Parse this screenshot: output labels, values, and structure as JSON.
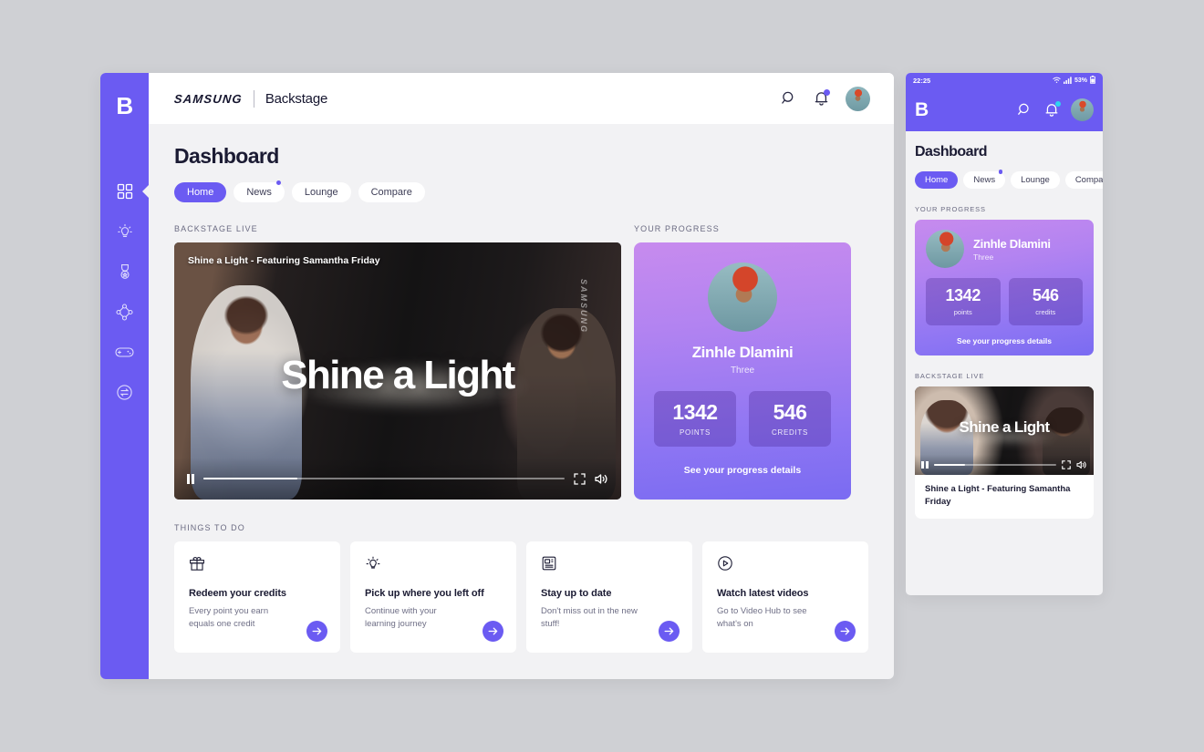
{
  "desktop": {
    "sidebar": {
      "brand_initial": "B",
      "items": [
        {
          "name": "dashboard",
          "icon": "grid-icon",
          "active": true
        },
        {
          "name": "ideas",
          "icon": "lightbulb-icon",
          "active": false
        },
        {
          "name": "awards",
          "icon": "medal-icon",
          "active": false
        },
        {
          "name": "network",
          "icon": "nodes-icon",
          "active": false
        },
        {
          "name": "games",
          "icon": "gamepad-icon",
          "active": false
        },
        {
          "name": "transfer",
          "icon": "swap-circle-icon",
          "active": false
        }
      ]
    },
    "topbar": {
      "samsung": "SAMSUNG",
      "product": "Backstage",
      "search_icon": "search-icon",
      "bell_icon": "bell-icon",
      "avatar": "user-avatar"
    },
    "page_title": "Dashboard",
    "tabs": [
      {
        "label": "Home",
        "active": true,
        "dot": false
      },
      {
        "label": "News",
        "active": false,
        "dot": true
      },
      {
        "label": "Lounge",
        "active": false,
        "dot": false
      },
      {
        "label": "Compare",
        "active": false,
        "dot": false
      }
    ],
    "live": {
      "section_label": "BACKSTAGE LIVE",
      "overlay_title": "Shine a Light - Featuring Samantha Friday",
      "headline": "Shine a Light",
      "watermark": "SAMSUNG",
      "progress_percent": 26
    },
    "progress": {
      "section_label": "YOUR PROGRESS",
      "name": "Zinhle Dlamini",
      "level": "Three",
      "stats": [
        {
          "value": "1342",
          "label": "POINTS"
        },
        {
          "value": "546",
          "label": "CREDITS"
        }
      ],
      "link": "See your progress details"
    },
    "todo": {
      "section_label": "THINGS TO DO",
      "cards": [
        {
          "icon": "gift-icon",
          "title": "Redeem your credits",
          "desc": "Every point you earn equals one credit"
        },
        {
          "icon": "lightbulb-icon",
          "title": "Pick up where you left off",
          "desc": "Continue with your learning journey"
        },
        {
          "icon": "article-icon",
          "title": "Stay up to date",
          "desc": "Don't miss out in the new stuff!"
        },
        {
          "icon": "play-circle-icon",
          "title": "Watch latest videos",
          "desc": "Go to Video Hub to see what's on"
        }
      ]
    }
  },
  "mobile": {
    "status_bar": {
      "time": "22:25",
      "wifi_icon": "wifi-icon",
      "signal_icon": "signal-icon",
      "battery_text": "53%",
      "battery_icon": "battery-icon"
    },
    "header": {
      "brand_initial": "B",
      "search_icon": "search-icon",
      "bell_icon": "bell-icon",
      "avatar": "user-avatar"
    },
    "page_title": "Dashboard",
    "tabs": [
      {
        "label": "Home",
        "active": true,
        "dot": false
      },
      {
        "label": "News",
        "active": false,
        "dot": true
      },
      {
        "label": "Lounge",
        "active": false,
        "dot": false
      },
      {
        "label": "Compare",
        "active": false,
        "dot": false
      }
    ],
    "progress": {
      "section_label": "YOUR PROGRESS",
      "name": "Zinhle Dlamini",
      "level": "Three",
      "stats": [
        {
          "value": "1342",
          "label": "points"
        },
        {
          "value": "546",
          "label": "credits"
        }
      ],
      "link": "See your progress details"
    },
    "live": {
      "section_label": "BACKSTAGE LIVE",
      "headline": "Shine a Light",
      "caption": "Shine a Light - Featuring Samantha Friday",
      "progress_percent": 26
    }
  },
  "colors": {
    "accent": "#6b5bf2",
    "card_gradient_start": "#c78bee",
    "card_gradient_end": "#7a6bf2",
    "page_bg": "#f2f2f4",
    "notification_dot_mobile": "#2ed3f0"
  }
}
